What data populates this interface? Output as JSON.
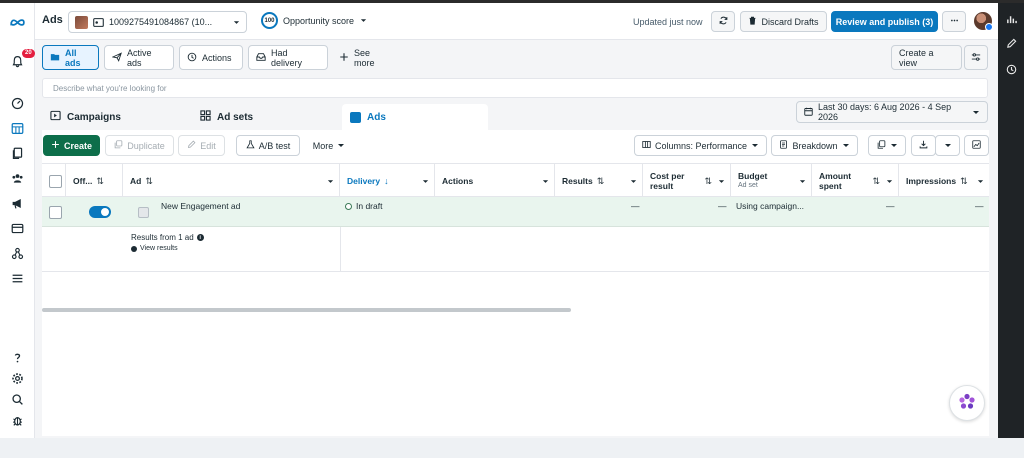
{
  "app": {
    "title": "Ads"
  },
  "account": {
    "name": "1009275491084867 (10..."
  },
  "opportunity": {
    "score": "100",
    "label": "Opportunity score"
  },
  "header": {
    "updated": "Updated just now",
    "discard": "Discard Drafts",
    "publish": "Review and publish (3)"
  },
  "notifications": {
    "count": "20"
  },
  "filters": {
    "all_ads": "All ads",
    "active_ads": "Active ads",
    "actions": "Actions",
    "had_delivery": "Had delivery",
    "see_more": "See more",
    "create_view": "Create a view"
  },
  "search": {
    "placeholder": "Describe what you're looking for"
  },
  "tabs": {
    "campaigns": "Campaigns",
    "ad_sets": "Ad sets",
    "ads": "Ads"
  },
  "date_range": {
    "label": "Last 30 days: 6 Aug 2026 - 4 Sep 2026"
  },
  "toolbar": {
    "create": "Create",
    "duplicate": "Duplicate",
    "edit": "Edit",
    "ab_test": "A/B test",
    "more": "More",
    "columns": "Columns: Performance",
    "breakdown": "Breakdown"
  },
  "table": {
    "columns": {
      "off_on": "Off...",
      "ad": "Ad",
      "delivery": "Delivery",
      "actions": "Actions",
      "results": "Results",
      "cost_per_result_1": "Cost per",
      "cost_per_result_2": "result",
      "budget": "Budget",
      "budget_sub": "Ad set",
      "amount_spent_1": "Amount",
      "amount_spent_2": "spent",
      "impressions": "Impressions"
    },
    "rows": [
      {
        "ad_name": "New Engagement ad",
        "delivery": "In draft",
        "results": "—",
        "cost_per_result": "—",
        "budget": "Using campaign...",
        "amount_spent": "—",
        "impressions": "—"
      }
    ],
    "summary": {
      "results_from": "Results from 1 ad",
      "view_results": "View results"
    }
  },
  "colors": {
    "accent": "#0a78be",
    "create_green": "#0d6e4a",
    "row_highlight": "#e9f5ee"
  }
}
